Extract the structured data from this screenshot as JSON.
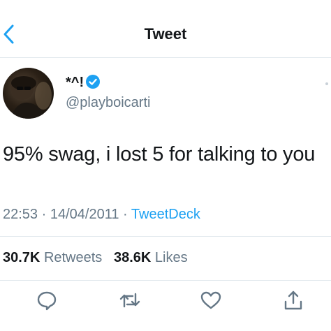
{
  "header": {
    "title": "Tweet"
  },
  "author": {
    "display_name": "*^!",
    "handle": "@playboicarti",
    "verified": true
  },
  "tweet": {
    "text": "95% swag, i lost 5 for talking to you",
    "time": "22:53",
    "date": "14/04/2011",
    "separator": "·",
    "source": "TweetDeck"
  },
  "stats": {
    "retweets_count": "30.7K",
    "retweets_label": "Retweets",
    "likes_count": "38.6K",
    "likes_label": "Likes"
  },
  "colors": {
    "accent": "#1da1f2",
    "muted": "#657786",
    "text": "#14171a",
    "border": "#e1e8ed"
  },
  "icons": {
    "back": "chevron-left-icon",
    "verified": "verified-badge-icon",
    "reply": "reply-icon",
    "retweet": "retweet-icon",
    "like": "heart-icon",
    "share": "share-icon"
  }
}
